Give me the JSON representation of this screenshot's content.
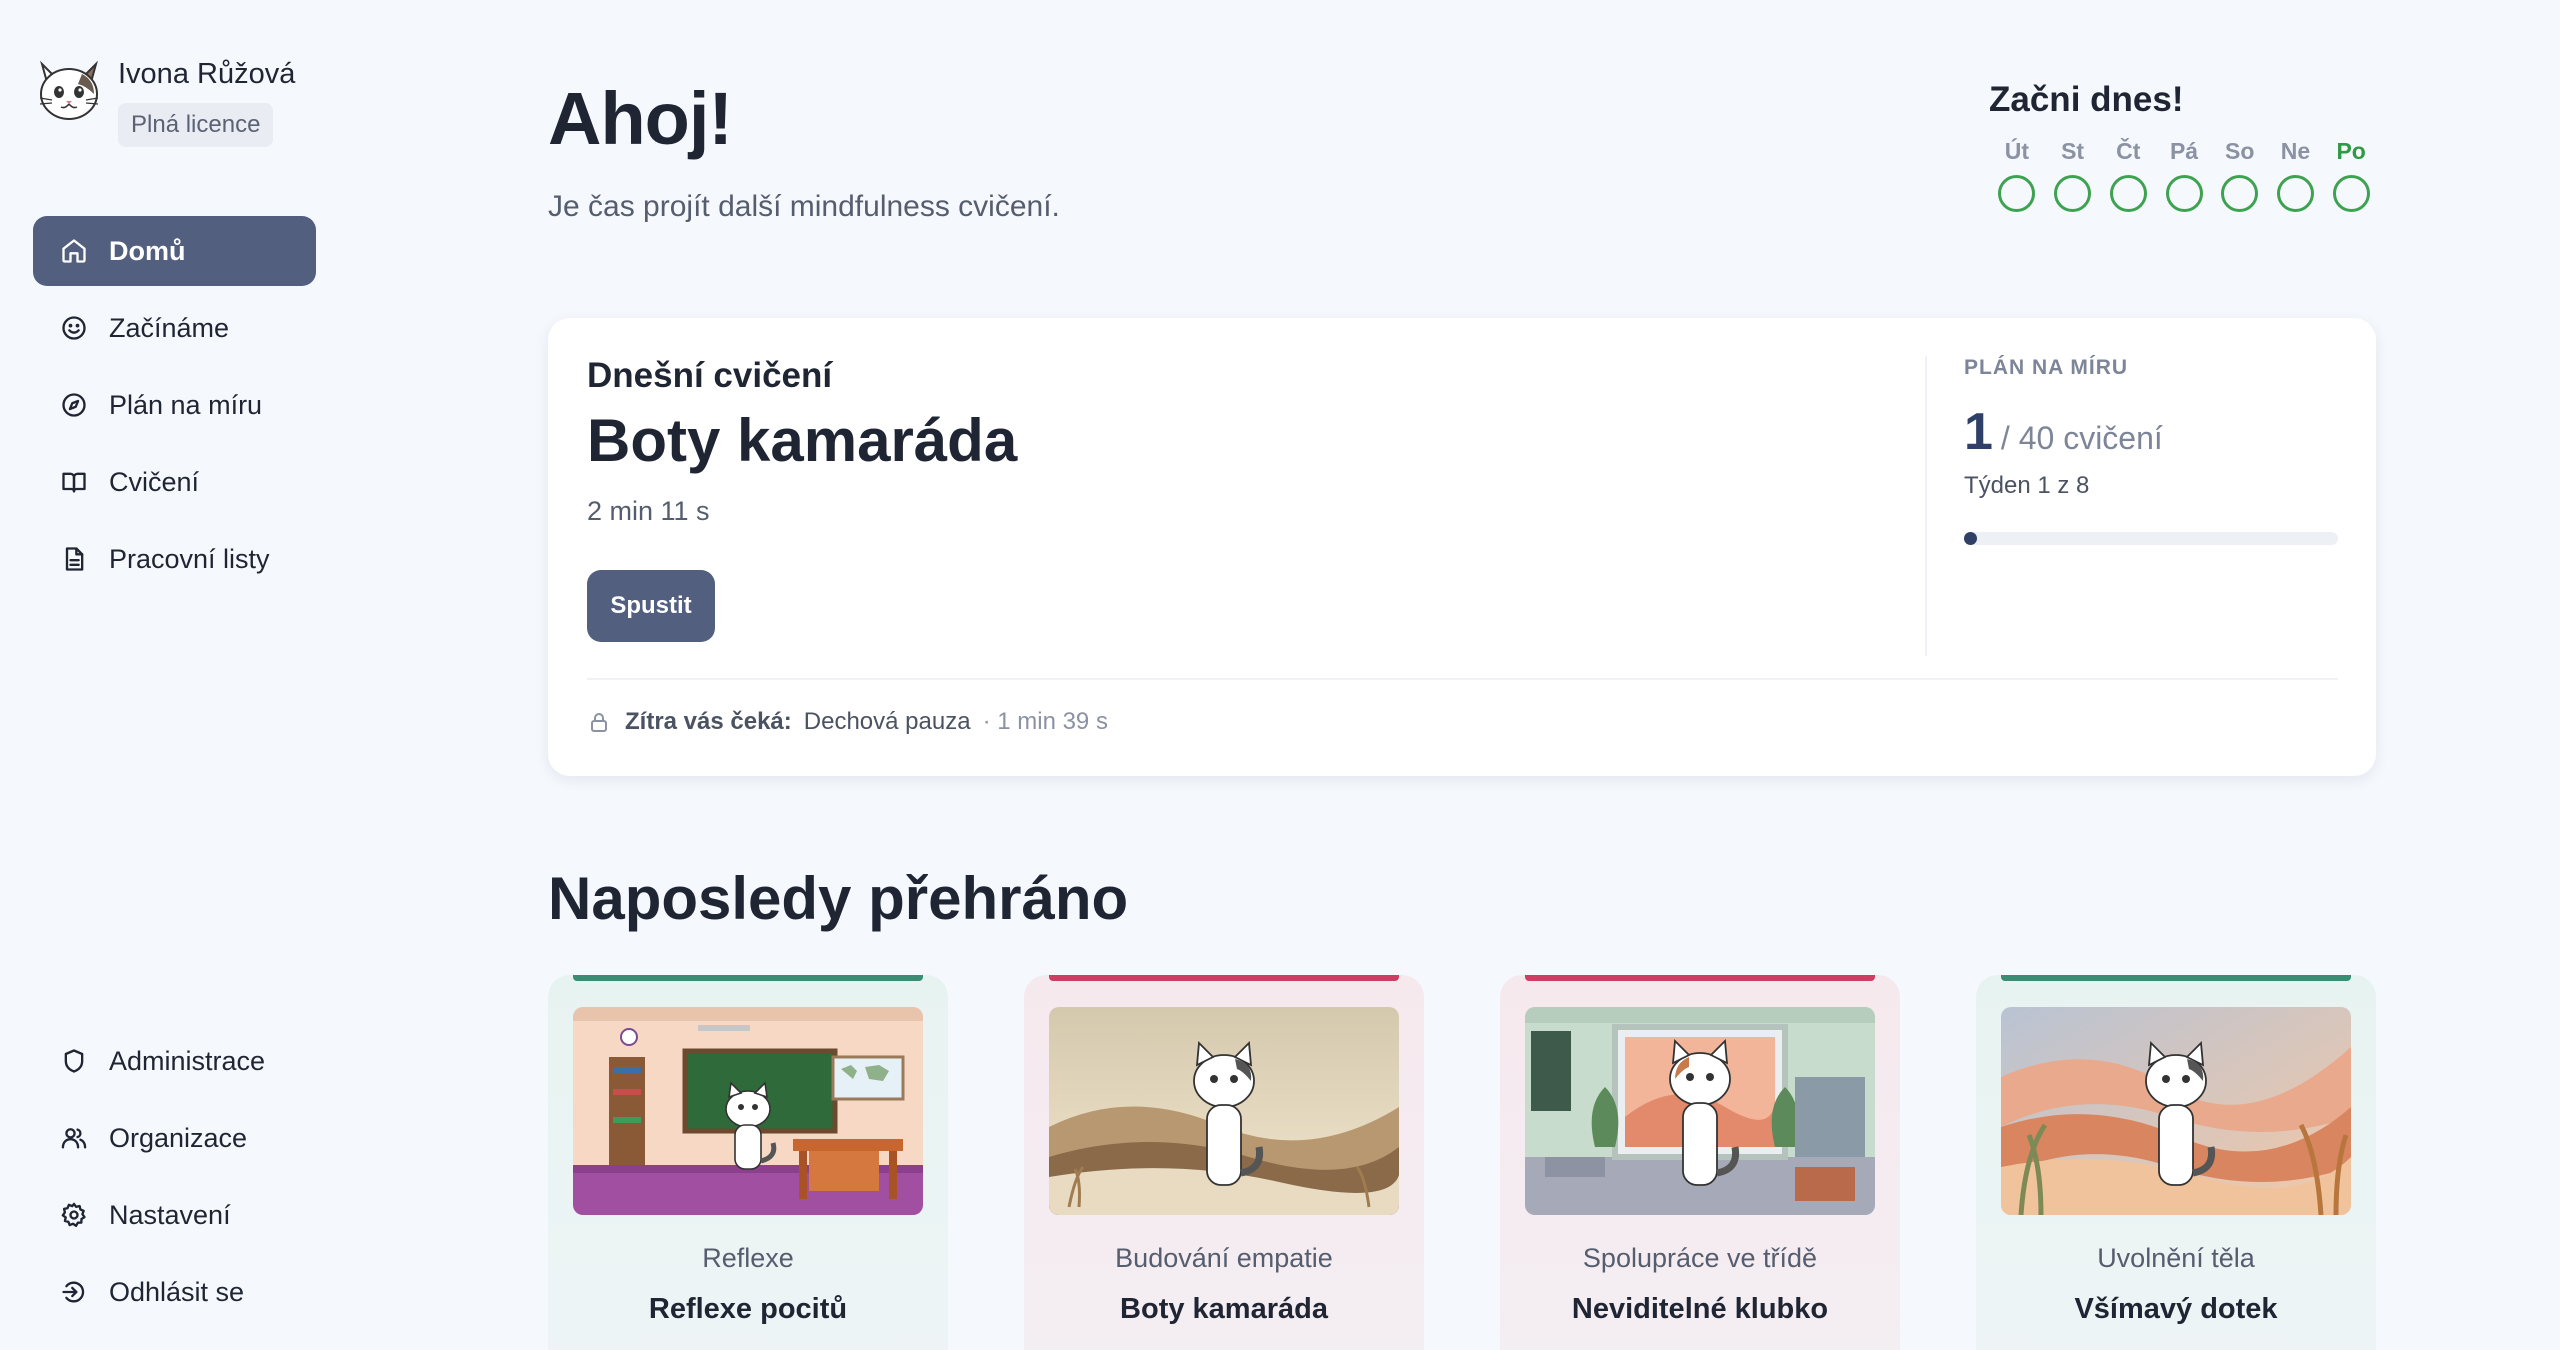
{
  "user": {
    "name": "Ivona Růžová",
    "license": "Plná licence",
    "avatar_icon": "cat-face-icon"
  },
  "nav": {
    "items": [
      {
        "label": "Domů",
        "icon": "home-icon",
        "active": true
      },
      {
        "label": "Začínáme",
        "icon": "smile-icon"
      },
      {
        "label": "Plán na míru",
        "icon": "compass-icon"
      },
      {
        "label": "Cvičení",
        "icon": "book-icon"
      },
      {
        "label": "Pracovní listy",
        "icon": "document-icon"
      }
    ],
    "bottom": [
      {
        "label": "Administrace",
        "icon": "shield-icon"
      },
      {
        "label": "Organizace",
        "icon": "users-icon"
      },
      {
        "label": "Nastavení",
        "icon": "gear-icon"
      },
      {
        "label": "Odhlásit se",
        "icon": "logout-icon"
      }
    ]
  },
  "header": {
    "greeting": "Ahoj!",
    "subtitle": "Je čas projít další mindfulness cvičení."
  },
  "streak": {
    "title": "Začni dnes!",
    "days": [
      {
        "label": "Út"
      },
      {
        "label": "St"
      },
      {
        "label": "Čt"
      },
      {
        "label": "Pá"
      },
      {
        "label": "So"
      },
      {
        "label": "Ne"
      },
      {
        "label": "Po",
        "today": true
      }
    ],
    "accent_color": "#3ea351"
  },
  "today": {
    "label": "Dnešní cvičení",
    "title": "Boty kamaráda",
    "duration": "2 min 11 s",
    "play_label": "Spustit",
    "plan": {
      "label": "PLÁN NA MÍRU",
      "current": "1",
      "total": "/ 40 cvičení",
      "week": "Týden 1 z 8",
      "progress_fraction": 0.025
    },
    "tomorrow": {
      "label": "Zítra vás čeká:",
      "title": "Dechová pauza",
      "duration": "· 1 min 39 s"
    }
  },
  "recent": {
    "title": "Naposledy přehráno",
    "items": [
      {
        "category": "Reflexe",
        "name": "Reflexe pocitů",
        "accent": "green",
        "scene": "classroom"
      },
      {
        "category": "Budování empatie",
        "name": "Boty kamaráda",
        "accent": "pink",
        "scene": "desert"
      },
      {
        "category": "Spolupráce ve třídě",
        "name": "Neviditelné klubko",
        "accent": "pink",
        "scene": "classroom-window"
      },
      {
        "category": "Uvolnění těla",
        "name": "Všímavý dotek",
        "accent": "green",
        "scene": "waves"
      }
    ]
  },
  "colors": {
    "primary": "#525f7f",
    "green": "#3a8c72",
    "pink": "#cc3f63",
    "background": "#f5f8fd"
  }
}
